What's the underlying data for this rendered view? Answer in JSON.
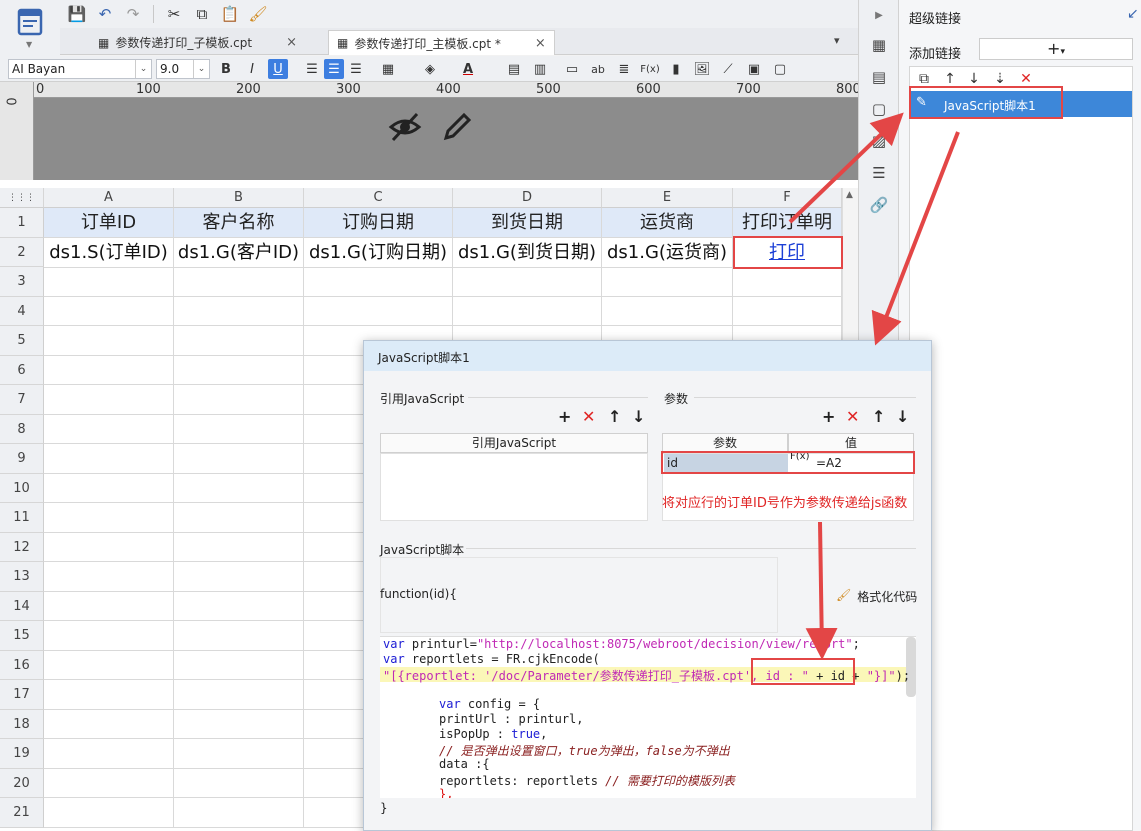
{
  "toolbar": {
    "icons": [
      "save-icon",
      "undo-icon",
      "redo-icon",
      "cut-icon",
      "copy-icon",
      "paste-icon",
      "format-brush-icon"
    ]
  },
  "tabs": [
    {
      "label": "参数传递打印_子模板.cpt",
      "close": "×"
    },
    {
      "label": "参数传递打印_主模板.cpt *",
      "close": "×"
    }
  ],
  "format": {
    "font": "AI Bayan",
    "size": "9.0",
    "bold": "B",
    "italic": "I",
    "underline": "U",
    "text_tool": "ab",
    "formula": "F(x)"
  },
  "ruler": {
    "marks": [
      "0",
      "100",
      "200",
      "300",
      "400",
      "500",
      "600",
      "700",
      "800"
    ],
    "v_mark": "0"
  },
  "grid": {
    "columns": [
      "A",
      "B",
      "C",
      "D",
      "E",
      "F"
    ],
    "rows": [
      "1",
      "2",
      "3",
      "4",
      "5",
      "6",
      "7",
      "8",
      "9",
      "10",
      "11",
      "12",
      "13",
      "14",
      "15",
      "16",
      "17",
      "18",
      "19",
      "20",
      "21"
    ],
    "header_row": [
      "订单ID",
      "客户名称",
      "订购日期",
      "到货日期",
      "运货商",
      "打印订单明"
    ],
    "data_row": [
      "ds1.S(订单ID)",
      "ds1.G(客户ID)",
      "ds1.G(订购日期)",
      "ds1.G(到货日期)",
      "ds1.G(运货商)",
      "打印"
    ]
  },
  "panel": {
    "title": "超级链接",
    "add_label": "添加链接",
    "add_btn": "+",
    "item": "JavaScript脚本1"
  },
  "dialog": {
    "title": "JavaScript脚本1",
    "ref_js_section": "引用JavaScript",
    "ref_js_column": "引用JavaScript",
    "params_section": "参数",
    "param_col_name": "参数",
    "param_col_value": "值",
    "param_name": "id",
    "param_fx": "F(x)",
    "param_value": "=A2",
    "script_section": "JavaScript脚本",
    "function_sig": "function(id){",
    "format_code": "格式化代码",
    "closing": "}",
    "code": {
      "l1_kw": "var",
      "l1_a": " printurl=",
      "l1_str": "\"http://localhost:8075/webroot/decision/view/report\"",
      "l1_b": ";",
      "l2_kw": "var",
      "l2_a": " reportlets = FR.cjkEncode(",
      "l3_str": "\"[{reportlet: '/doc/Parameter/参数传递打印_子模板.cpt', id : \"",
      "l3_a": " + id + ",
      "l3_str2": "\"}]\"",
      "l3_b": ");",
      "l4_kw": "var",
      "l4_a": " config = {",
      "l5": "printUrl : printurl,",
      "l6_a": "isPopUp : ",
      "l6_kw": "true",
      "l6_b": ",",
      "l7": "// 是否弹出设置窗口，true为弹出，false为不弹出",
      "l8": "data :{",
      "l9_a": "reportlets: reportlets ",
      "l9_cm": "// 需要打印的模版列表",
      "l10": "},"
    }
  },
  "annotation": "将对应行的订单ID号作为参数传递给js函数",
  "colors": {
    "accent": "#3d87d9",
    "annotation_red": "#e34646",
    "header_fill": "#dfe9f8",
    "link_blue": "#1b3fd6"
  }
}
